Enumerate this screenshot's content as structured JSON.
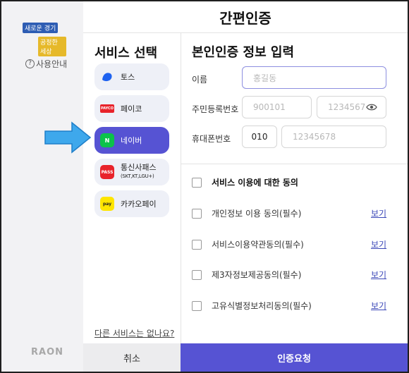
{
  "app": {
    "title": "간편인증",
    "logo_line1": "새로운 경기",
    "logo_line2": "공정한 세상",
    "guide": "사용안내",
    "brand": "RAON"
  },
  "services": {
    "heading": "서비스 선택",
    "items": [
      {
        "label": "토스",
        "icon": "toss-icon"
      },
      {
        "label": "페이코",
        "icon": "payco-icon",
        "badge": "PAYCO"
      },
      {
        "label": "네이버",
        "icon": "naver-icon",
        "badge": "N",
        "selected": true
      },
      {
        "label": "통신사패스",
        "sub": "(SKT,KT,LGU+)",
        "icon": "pass-icon",
        "badge": "PASS"
      },
      {
        "label": "카카오페이",
        "icon": "kakaopay-icon",
        "badge": "pay"
      }
    ],
    "other_link": "다른 서비스는 없나요?"
  },
  "form": {
    "heading": "본인인증 정보 입력",
    "name_label": "이름",
    "name_placeholder": "홍길동",
    "rrn_label": "주민등록번호",
    "rrn_front_placeholder": "900101",
    "rrn_back_placeholder": "1234567",
    "phone_label": "휴대폰번호",
    "carrier_value": "010",
    "phone_placeholder": "12345678"
  },
  "consent": {
    "all_label": "서비스 이용에 대한 동의",
    "view_label": "보기",
    "items": [
      "개인정보 이용 동의(필수)",
      "서비스이용약관동의(필수)",
      "제3자정보제공동의(필수)",
      "고유식별정보처리동의(필수)"
    ]
  },
  "footer": {
    "cancel": "취소",
    "submit": "인증요청"
  },
  "colors": {
    "accent": "#5653d3",
    "link": "#3b47b8",
    "arrow": "#3ea8ec"
  }
}
